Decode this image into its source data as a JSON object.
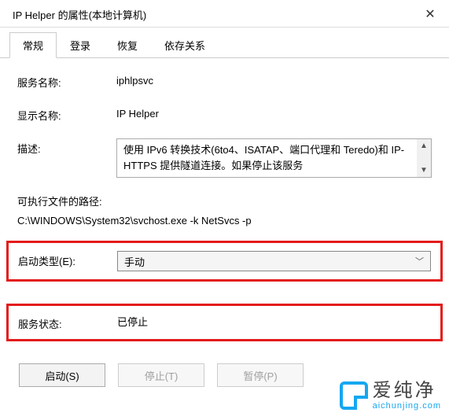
{
  "titlebar": {
    "title": "IP Helper 的属性(本地计算机)"
  },
  "tabs": {
    "general": "常规",
    "logon": "登录",
    "recovery": "恢复",
    "dependencies": "依存关系"
  },
  "labels": {
    "service_name": "服务名称:",
    "display_name": "显示名称:",
    "description": "描述:",
    "exe_path": "可执行文件的路径:",
    "startup_type": "启动类型(E):",
    "service_status": "服务状态:"
  },
  "values": {
    "service_name": "iphlpsvc",
    "display_name": "IP Helper",
    "description": "使用 IPv6 转换技术(6to4、ISATAP、端口代理和 Teredo)和 IP-HTTPS 提供隧道连接。如果停止该服务",
    "exe_path": "C:\\WINDOWS\\System32\\svchost.exe -k NetSvcs -p",
    "startup_type": "手动",
    "service_status": "已停止"
  },
  "buttons": {
    "start": "启动(S)",
    "stop": "停止(T)",
    "pause": "暂停(P)"
  },
  "watermark": {
    "cn": "爱纯净",
    "en": "aichunjing.com"
  }
}
